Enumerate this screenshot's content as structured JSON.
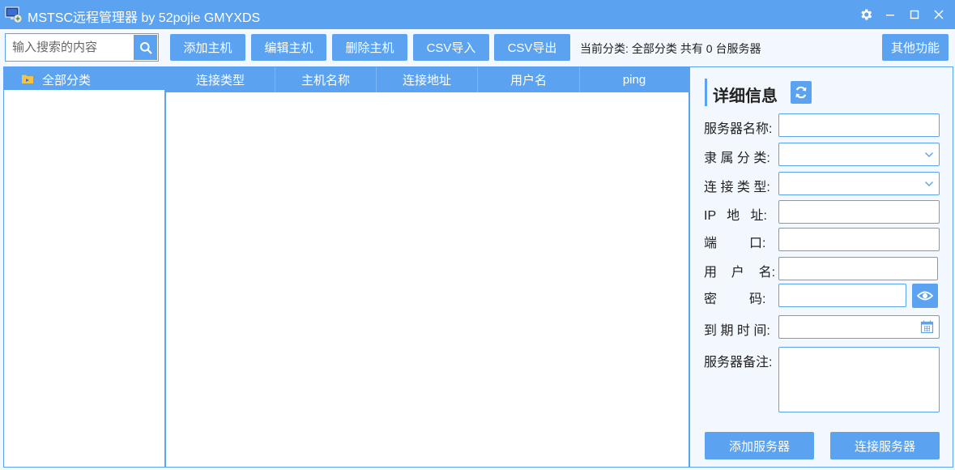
{
  "window": {
    "title": "MSTSC远程管理器 by 52pojie GMYXDS",
    "icons": [
      "app-icon",
      "gear-icon",
      "minimize-icon",
      "maximize-icon",
      "close-icon"
    ]
  },
  "search": {
    "placeholder": "输入搜索的内容",
    "icon": "search-icon"
  },
  "toolbar": {
    "add_host": "添加主机",
    "edit_host": "编辑主机",
    "delete_host": "删除主机",
    "csv_import": "CSV导入",
    "csv_export": "CSV导出",
    "current_category_label": "当前分类:",
    "current_category_value": "全部分类",
    "server_count_text": "共有 0 台服务器",
    "other_functions": "其他功能"
  },
  "tree": {
    "items": [
      {
        "label": "全部分类",
        "icon": "folder-icon",
        "selected": true
      }
    ]
  },
  "table": {
    "columns": [
      "连接类型",
      "主机名称",
      "连接地址",
      "用户名",
      "ping"
    ],
    "rows": []
  },
  "detail": {
    "title": "详细信息",
    "refresh_icon": "refresh-icon",
    "fields": {
      "server_name": "服务器名称:",
      "category": "隶 属 分 类:",
      "connection_type": "连 接 类 型:",
      "ip_address": "IP   地   址:",
      "port": "端         口:",
      "username": "用    户    名:",
      "password": "密         码:",
      "expiry": "到 期 时 间:",
      "remarks": "服务器备注:"
    },
    "values": {
      "server_name": "",
      "category": "",
      "connection_type": "",
      "ip_address": "",
      "port": "",
      "username": "",
      "password": "",
      "expiry": "",
      "remarks": ""
    },
    "add_server": "添加服务器",
    "connect_server": "连接服务器"
  },
  "colors": {
    "accent": "#5ba3f0",
    "background": "#f3f8fe",
    "folder": "#f5c342"
  }
}
